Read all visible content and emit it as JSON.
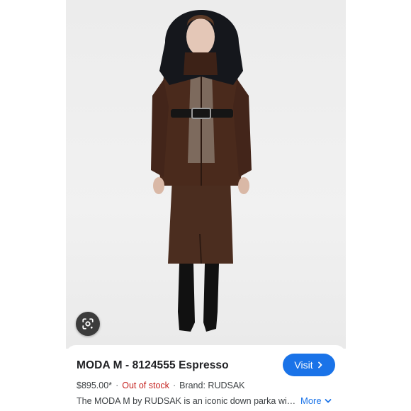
{
  "result": {
    "title": "MODA M - 8124555 Espresso",
    "visit_label": "Visit",
    "price": "$895.00*",
    "stock_status": "Out of stock",
    "separator": "·",
    "brand": "Brand: RUDSAK",
    "description": "The MODA M by RUDSAK is an iconic down parka with a detachable fur trim...",
    "more_label": "More"
  },
  "icons": {
    "lens": "google-lens-icon",
    "visit_chevron": "chevron-right-icon",
    "more_chevron": "chevron-down-icon"
  },
  "colors": {
    "accent": "#1a73e8",
    "out_of_stock": "#c5221f",
    "coat": "#4a2a1c"
  }
}
